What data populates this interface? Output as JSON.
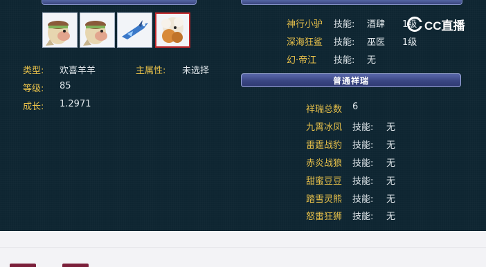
{
  "pet_slots": [
    {
      "icon": "sheep-pet-icon",
      "selected": false
    },
    {
      "icon": "sheep-pet-icon",
      "selected": false
    },
    {
      "icon": "blue-jet-icon",
      "selected": false
    },
    {
      "icon": "brown-sheep-pet-icon",
      "selected": true
    }
  ],
  "pet_info": {
    "type_label": "类型:",
    "type_value": "欢喜羊羊",
    "attr_label": "主属性:",
    "attr_value": "未选择",
    "level_label": "等级:",
    "level_value": "85",
    "growth_label": "成长:",
    "growth_value": "1.2971"
  },
  "mounts": [
    {
      "name": "神行小驴",
      "skill_label": "技能:",
      "skill_value": "酒肆",
      "level": "1级"
    },
    {
      "name": "深海狂鲨",
      "skill_label": "技能:",
      "skill_value": "巫医",
      "level": "1级"
    },
    {
      "name": "幻·帝江",
      "skill_label": "技能:",
      "skill_value": "无",
      "level": ""
    }
  ],
  "section_title": "普通祥瑞",
  "auspicious": {
    "total_label": "祥瑞总数",
    "total_value": "6",
    "items": [
      {
        "name": "九霄冰凤",
        "skill_label": "技能:",
        "skill_value": "无"
      },
      {
        "name": "雷霆战豹",
        "skill_label": "技能:",
        "skill_value": "无"
      },
      {
        "name": "赤炎战狼",
        "skill_label": "技能:",
        "skill_value": "无"
      },
      {
        "name": "甜蜜豆豆",
        "skill_label": "技能:",
        "skill_value": "无"
      },
      {
        "name": "踏雪灵熊",
        "skill_label": "技能:",
        "skill_value": "无"
      },
      {
        "name": "怒雷狂狮",
        "skill_label": "技能:",
        "skill_value": "无"
      }
    ]
  },
  "watermark": {
    "text": "CC直播",
    "icon": "cc-live-logo-icon"
  },
  "colors": {
    "panel": "#0e2531",
    "gold": "#e7c04a",
    "selected_border": "#c0282c"
  }
}
